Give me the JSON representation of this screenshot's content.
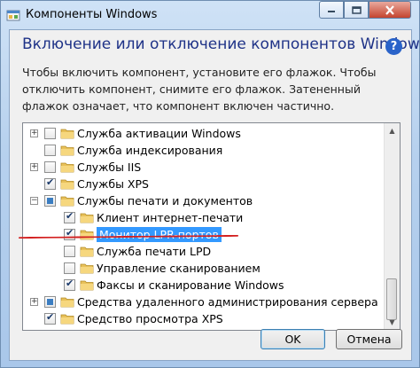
{
  "window": {
    "title": "Компоненты Windows",
    "icon": "windows-features-icon"
  },
  "header": {
    "heading": "Включение или отключение компонентов Windows",
    "help_icon": "help-icon"
  },
  "description": "Чтобы включить компонент, установите его флажок. Чтобы отключить компонент, снимите его флажок. Затененный флажок означает, что компонент включен частично.",
  "tree": {
    "items": [
      {
        "label": "Служба активации Windows",
        "level": 0,
        "expander": "+",
        "state": "unchecked"
      },
      {
        "label": "Служба индексирования",
        "level": 0,
        "expander": "",
        "state": "unchecked"
      },
      {
        "label": "Службы IIS",
        "level": 0,
        "expander": "+",
        "state": "unchecked"
      },
      {
        "label": "Службы XPS",
        "level": 0,
        "expander": "",
        "state": "checked"
      },
      {
        "label": "Службы печати и документов",
        "level": 0,
        "expander": "−",
        "state": "partial"
      },
      {
        "label": "Клиент интернет-печати",
        "level": 1,
        "expander": "",
        "state": "checked"
      },
      {
        "label": "Монитор LPR-портов",
        "level": 1,
        "expander": "",
        "state": "checked",
        "selected": true
      },
      {
        "label": "Служба печати LPD",
        "level": 1,
        "expander": "",
        "state": "unchecked"
      },
      {
        "label": "Управление сканированием",
        "level": 1,
        "expander": "",
        "state": "unchecked"
      },
      {
        "label": "Факсы и сканирование Windows",
        "level": 1,
        "expander": "",
        "state": "checked"
      },
      {
        "label": "Средства удаленного администрирования сервера",
        "level": 0,
        "expander": "+",
        "state": "partial"
      },
      {
        "label": "Средство просмотра XPS",
        "level": 0,
        "expander": "",
        "state": "checked"
      },
      {
        "label": "",
        "level": 0,
        "expander": "",
        "state": "unchecked"
      }
    ]
  },
  "buttons": {
    "ok": "OK",
    "cancel": "Отмена"
  },
  "colors": {
    "selection": "#3399ff",
    "heading": "#1e3287",
    "annotation_line": "#d32020",
    "folder": "#e8c15a"
  }
}
